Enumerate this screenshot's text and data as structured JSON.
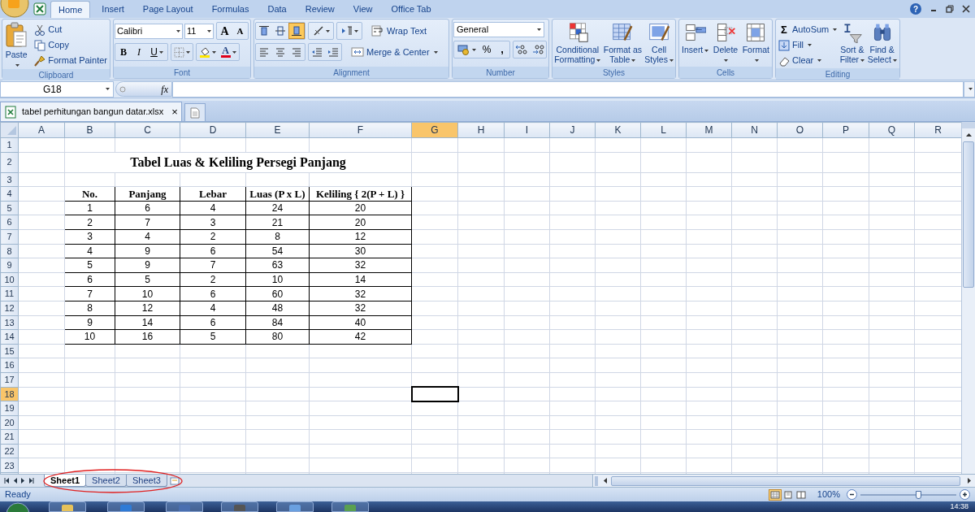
{
  "menu_tabs": [
    {
      "label": "Home",
      "selected": true
    },
    {
      "label": "Insert",
      "selected": false
    },
    {
      "label": "Page Layout",
      "selected": false
    },
    {
      "label": "Formulas",
      "selected": false
    },
    {
      "label": "Data",
      "selected": false
    },
    {
      "label": "Review",
      "selected": false
    },
    {
      "label": "View",
      "selected": false
    },
    {
      "label": "Office Tab",
      "selected": false
    }
  ],
  "help": "?",
  "ribbon": {
    "clipboard": {
      "label": "Clipboard",
      "paste": "Paste",
      "cut": "Cut",
      "copy": "Copy",
      "format_painter": "Format Painter"
    },
    "font": {
      "label": "Font",
      "font_name": "Calibri",
      "font_size": "11",
      "grow": "A",
      "shrink": "A",
      "bold": "B",
      "italic": "I",
      "underline": "U",
      "font_color": "A"
    },
    "alignment": {
      "label": "Alignment",
      "vertical": [
        {
          "selected": false
        },
        {
          "selected": false
        },
        {
          "selected": true
        }
      ],
      "wrap_text": "Wrap Text",
      "merge_center": "Merge & Center"
    },
    "number": {
      "label": "Number",
      "format": "General",
      "percent": "%",
      "comma": ","
    },
    "styles": {
      "label": "Styles",
      "buttons": [
        "Conditional Formatting",
        "Format as Table",
        "Cell Styles"
      ]
    },
    "cells": {
      "label": "Cells",
      "buttons": [
        "Insert",
        "Delete",
        "Format"
      ]
    },
    "editing": {
      "label": "Editing",
      "sigma": "Σ",
      "autosum": "AutoSum",
      "fill": "Fill",
      "clear": "Clear",
      "buttons": [
        "Sort & Filter",
        "Find & Select"
      ]
    }
  },
  "formula_bar": {
    "name_box": "G18",
    "fx": "fx"
  },
  "document_tab": {
    "label": "tabel perhitungan bangun datar.xlsx",
    "close": "×"
  },
  "sheet": {
    "columns": [
      {
        "label": "A",
        "selected": false
      },
      {
        "label": "B",
        "selected": false
      },
      {
        "label": "C",
        "selected": false
      },
      {
        "label": "D",
        "selected": false
      },
      {
        "label": "E",
        "selected": false
      },
      {
        "label": "F",
        "selected": false
      },
      {
        "label": "G",
        "selected": true
      },
      {
        "label": "H",
        "selected": false
      },
      {
        "label": "I",
        "selected": false
      },
      {
        "label": "J",
        "selected": false
      },
      {
        "label": "K",
        "selected": false
      },
      {
        "label": "L",
        "selected": false
      },
      {
        "label": "M",
        "selected": false
      },
      {
        "label": "N",
        "selected": false
      },
      {
        "label": "O",
        "selected": false
      },
      {
        "label": "P",
        "selected": false
      },
      {
        "label": "Q",
        "selected": false
      },
      {
        "label": "R",
        "selected": false
      }
    ],
    "rows": [
      {
        "label": "1",
        "selected": false
      },
      {
        "label": "2",
        "selected": false
      },
      {
        "label": "3",
        "selected": false
      },
      {
        "label": "4",
        "selected": false
      },
      {
        "label": "5",
        "selected": false
      },
      {
        "label": "6",
        "selected": false
      },
      {
        "label": "7",
        "selected": false
      },
      {
        "label": "8",
        "selected": false
      },
      {
        "label": "9",
        "selected": false
      },
      {
        "label": "10",
        "selected": false
      },
      {
        "label": "11",
        "selected": false
      },
      {
        "label": "12",
        "selected": false
      },
      {
        "label": "13",
        "selected": false
      },
      {
        "label": "14",
        "selected": false
      },
      {
        "label": "15",
        "selected": false
      },
      {
        "label": "16",
        "selected": false
      },
      {
        "label": "17",
        "selected": false
      },
      {
        "label": "18",
        "selected": true
      },
      {
        "label": "19",
        "selected": false
      },
      {
        "label": "20",
        "selected": false
      },
      {
        "label": "21",
        "selected": false
      },
      {
        "label": "22",
        "selected": false
      },
      {
        "label": "23",
        "selected": false
      }
    ],
    "title": "Tabel Luas & Keliling Persegi Panjang",
    "table": {
      "columns": [
        "No.",
        "Panjang",
        "Lebar",
        "Luas (P x L)",
        "Keliling { 2(P + L) }"
      ],
      "rows": [
        [
          "1",
          "6",
          "4",
          "24",
          "20"
        ],
        [
          "2",
          "7",
          "3",
          "21",
          "20"
        ],
        [
          "3",
          "4",
          "2",
          "8",
          "12"
        ],
        [
          "4",
          "9",
          "6",
          "54",
          "30"
        ],
        [
          "5",
          "9",
          "7",
          "63",
          "32"
        ],
        [
          "6",
          "5",
          "2",
          "10",
          "14"
        ],
        [
          "7",
          "10",
          "6",
          "60",
          "32"
        ],
        [
          "8",
          "12",
          "4",
          "48",
          "32"
        ],
        [
          "9",
          "14",
          "6",
          "84",
          "40"
        ],
        [
          "10",
          "16",
          "5",
          "80",
          "42"
        ]
      ]
    }
  },
  "sheet_tabs": [
    {
      "label": "Sheet1",
      "selected": true
    },
    {
      "label": "Sheet2",
      "selected": false
    },
    {
      "label": "Sheet3",
      "selected": false
    }
  ],
  "status_bar": {
    "status": "Ready",
    "views": [
      {
        "selected": true
      },
      {
        "selected": false
      },
      {
        "selected": false
      }
    ],
    "zoom": "100%",
    "zoom_slider": {
      "level": 0.6
    }
  },
  "taskbar": {
    "clock": "14:38"
  }
}
